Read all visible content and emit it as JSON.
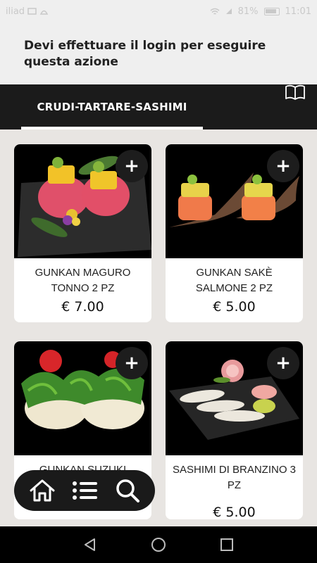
{
  "statusbar": {
    "carrier": "iliad",
    "battery": "81%",
    "time": "11:01"
  },
  "login_message": "Devi effettuare il login per eseguire questa azione",
  "category": {
    "label": "CRUDI-TARTARE-SASHIMI"
  },
  "products": [
    {
      "name": "GUNKAN MAGURO TONNO 2 PZ",
      "price": "€ 7.00",
      "add": "+"
    },
    {
      "name": "GUNKAN SAKÈ SALMONE 2 PZ",
      "price": "€ 5.00",
      "add": "+"
    },
    {
      "name": "GUNKAN SUZUKI BRANZINO",
      "price": "",
      "add": "+"
    },
    {
      "name": "SASHIMI DI BRANZINO  3 PZ",
      "price": "€ 5.00",
      "add": "+"
    }
  ],
  "icons": {
    "book": "book-icon",
    "home": "home-icon",
    "menu": "list-icon",
    "search": "search-icon",
    "back": "back-triangle-icon",
    "homebtn": "home-circle-icon",
    "recents": "recents-square-icon"
  },
  "colors": {
    "accent": "#1b1b1b",
    "background": "#e8e5e2",
    "card": "#ffffff"
  }
}
